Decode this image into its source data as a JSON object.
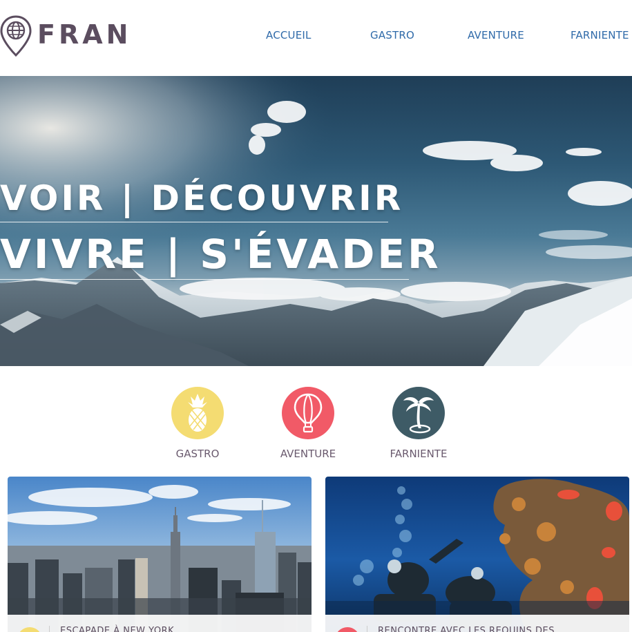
{
  "brand": {
    "name": "FRAN"
  },
  "nav": {
    "items": [
      {
        "label": "ACCUEIL"
      },
      {
        "label": "GASTRO"
      },
      {
        "label": "AVENTURE"
      },
      {
        "label": "FARNIENTE"
      }
    ]
  },
  "hero": {
    "line1": "VOIR | DÉCOUVRIR",
    "line2": "VIVRE | S'ÉVADER"
  },
  "categories": [
    {
      "label": "GASTRO",
      "icon": "pineapple-icon",
      "color": "#f4dc72"
    },
    {
      "label": "AVENTURE",
      "icon": "hot-air-balloon-icon",
      "color": "#f15a67"
    },
    {
      "label": "FARNIENTE",
      "icon": "palm-tree-icon",
      "color": "#3e5b66"
    }
  ],
  "cards": [
    {
      "title": "ESCAPADE À NEW YORK",
      "accent": "#f4dc72"
    },
    {
      "title": "RENCONTRE AVEC LES REQUINS DES",
      "accent": "#f15a67"
    }
  ],
  "colors": {
    "brand_text": "#5b4d5f",
    "nav_link": "#2f6aa9",
    "category_label": "#6a5a6e"
  }
}
